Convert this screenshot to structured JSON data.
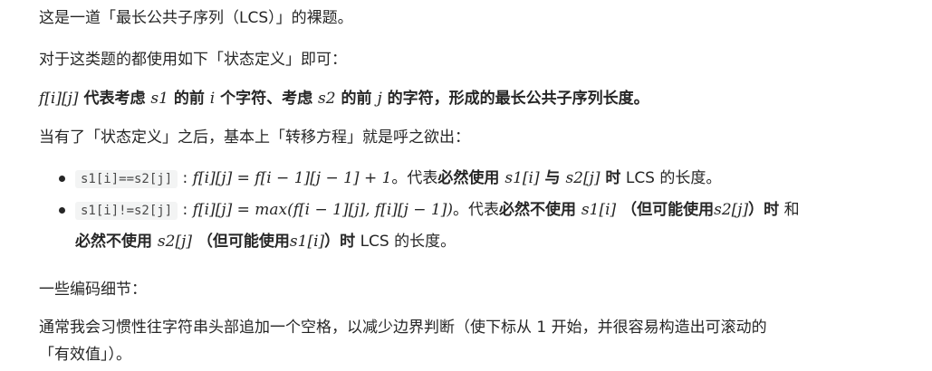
{
  "p1": "这是一道「最长公共子序列（LCS）」的裸题。",
  "p2": "对于这类题的都使用如下「状态定义」即可：",
  "p3": {
    "f": "f[i][j]",
    "t1": " 代表考虑 ",
    "s1": "s1",
    "t2": " 的前 ",
    "i": "i",
    "t3": " 个字符、考虑 ",
    "s2": "s2",
    "t4": " 的前 ",
    "j": "j",
    "t5": " 的字符，形成的最长公共子序列长度。"
  },
  "p4": "当有了「状态定义」之后，基本上「转移方程」就是呼之欲出：",
  "bullet1": {
    "code": "s1[i]==s2[j]",
    "sep": " : ",
    "eq": "f[i][j] = f[i − 1][j − 1] + 1",
    "t1": "。代表",
    "b1": "必然使用 ",
    "m1": "s1[i]",
    "b2": " 与 ",
    "m2": "s2[j]",
    "b3": " 时",
    "t2": " LCS 的长度。"
  },
  "bullet2": {
    "code": "s1[i]!=s2[j]",
    "sep": " : ",
    "eq": "f[i][j] = max(f[i − 1][j], f[i][j − 1])",
    "t1": "。代表",
    "b1": "必然不使用 ",
    "m1": "s1[i]",
    "b2": " （但可能使用",
    "m2": "s2[j]",
    "b3": "）时",
    "t2": " 和",
    "b4": "必然不使用 ",
    "m3": "s2[j]",
    "b5": " （但可能使用",
    "m4": "s1[i]",
    "b6": "）时",
    "t3": " LCS 的长度。"
  },
  "p5": "一些编码细节：",
  "p6a": "通常我会习惯性往字符串头部追加一个空格，以减少边界判断（使下标从 1 开始，并很容易构造出可滚动的",
  "p6b": "「有效值」）。"
}
